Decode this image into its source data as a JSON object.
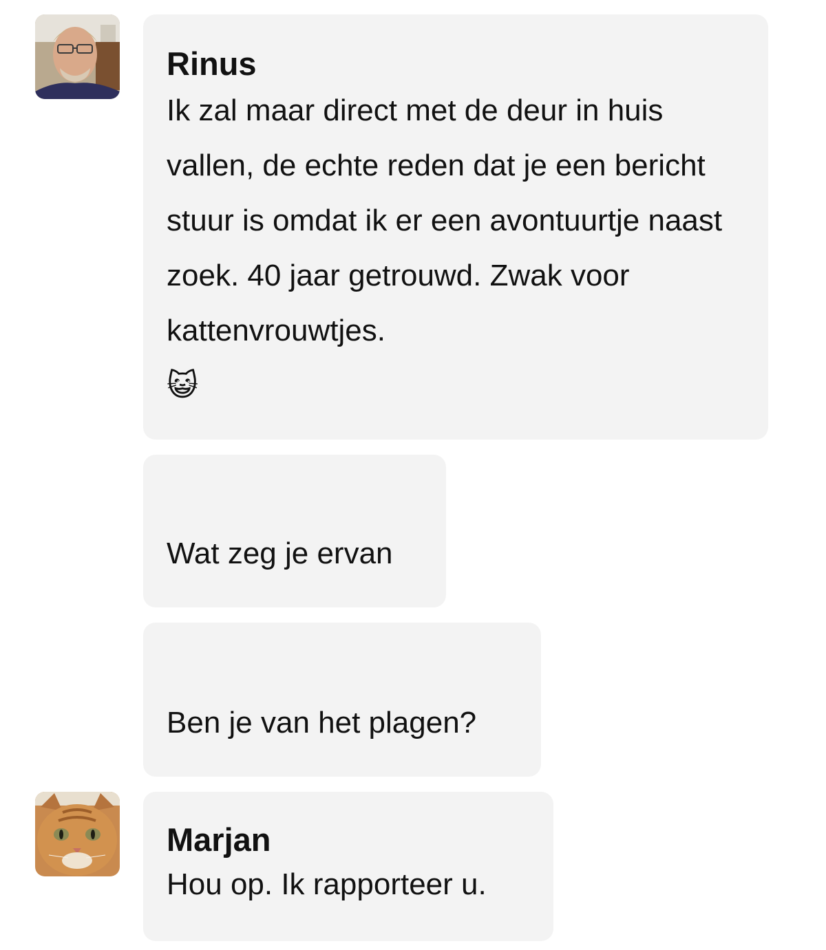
{
  "messages": [
    {
      "sender": "Rinus",
      "avatar": "man-with-glasses-photo",
      "text": "Ik zal maar direct met de deur in huis vallen, de echte reden dat je een bericht stuur is omdat ik er een avontuurtje naast zoek. 40 jaar getrouwd. Zwak voor kattenvrouwtjes.",
      "emoji": "😺",
      "emoji_name": "grinning-cat-emoji"
    },
    {
      "text": "Wat zeg je ervan"
    },
    {
      "text": "Ben je van het plagen?"
    },
    {
      "sender": "Marjan",
      "avatar": "orange-cat-photo",
      "text": "Hou op. Ik rapporteer u."
    }
  ],
  "colors": {
    "bubble_background": "#f3f3f3",
    "page_background": "#ffffff",
    "text": "#111111"
  }
}
